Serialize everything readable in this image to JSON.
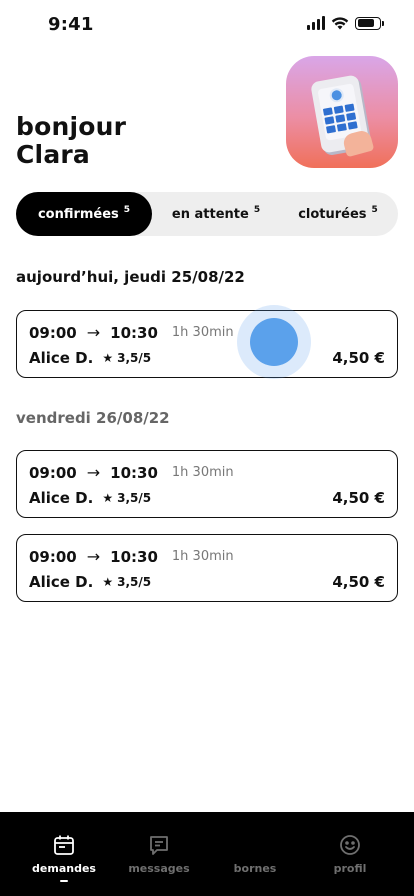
{
  "status_bar": {
    "time": "9:41"
  },
  "greeting": {
    "line1": "bonjour",
    "line2": "Clara"
  },
  "tabs": [
    {
      "label": "confirmées",
      "count": "5",
      "active": true
    },
    {
      "label": "en attente",
      "count": "5",
      "active": false
    },
    {
      "label": "cloturées",
      "count": "5",
      "active": false
    }
  ],
  "sections": [
    {
      "title": "aujourd’hui, jeudi 25/08/22",
      "bookings": [
        {
          "start": "09:00",
          "end": "10:30",
          "duration": "1h 30min",
          "name": "Alice D.",
          "rating": "3,5/5",
          "price": "4,50 €"
        }
      ]
    },
    {
      "title": "vendredi 26/08/22",
      "bookings": [
        {
          "start": "09:00",
          "end": "10:30",
          "duration": "1h 30min",
          "name": "Alice D.",
          "rating": "3,5/5",
          "price": "4,50 €"
        },
        {
          "start": "09:00",
          "end": "10:30",
          "duration": "1h 30min",
          "name": "Alice D.",
          "rating": "3,5/5",
          "price": "4,50 €"
        }
      ]
    }
  ],
  "icons": {
    "arrow": "→",
    "star": "★"
  },
  "bottom_nav": [
    {
      "label": "demandes",
      "icon": "calendar-icon",
      "active": true
    },
    {
      "label": "messages",
      "icon": "message-icon",
      "active": false
    },
    {
      "label": "bornes",
      "icon": "station-icon",
      "active": false
    },
    {
      "label": "profil",
      "icon": "smiley-icon",
      "active": false
    }
  ]
}
